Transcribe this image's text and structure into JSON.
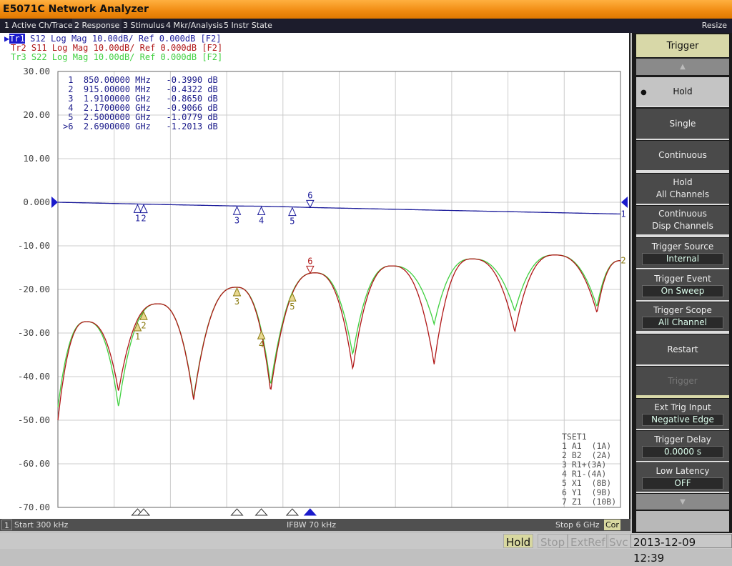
{
  "window": {
    "title": "E5071C Network Analyzer",
    "resize": "Resize"
  },
  "menu": [
    "1 Active Ch/Trace",
    "2 Response",
    "3 Stimulus",
    "4 Mkr/Analysis",
    "5 Instr State"
  ],
  "menu_active": 1,
  "traces": [
    {
      "id": "Tr1",
      "text": " S12 Log Mag 10.00dB/ Ref 0.000dB [F2]",
      "color": "#1a1a9a"
    },
    {
      "id": "Tr2",
      "text": " S11 Log Mag 10.00dB/ Ref 0.000dB [F2]",
      "color": "#b01818"
    },
    {
      "id": "Tr3",
      "text": " S22 Log Mag 10.00dB/ Ref 0.000dB [F2]",
      "color": "#40d040"
    }
  ],
  "markers": [
    {
      "label": " 1",
      "freq": "850.00000 MHz",
      "value": "-0.3990 dB"
    },
    {
      "label": " 2",
      "freq": "915.00000 MHz",
      "value": "-0.4322 dB"
    },
    {
      "label": " 3",
      "freq": "1.9100000 GHz",
      "value": "-0.8650 dB"
    },
    {
      "label": " 4",
      "freq": "2.1700000 GHz",
      "value": "-0.9066 dB"
    },
    {
      "label": " 5",
      "freq": "2.5000000 GHz",
      "value": "-1.0779 dB"
    },
    {
      "label": ">6",
      "freq": "2.6900000 GHz",
      "value": "-1.2013 dB"
    }
  ],
  "tset": [
    "TSET1",
    "1 A1  (1A)",
    "2 B2  (2A)",
    "3 R1+(3A)",
    "4 R1-(4A)",
    "5 X1  (8B)",
    "6 Y1  (9B)",
    "7 Z1  (10B)"
  ],
  "chart_data": {
    "type": "line",
    "xlim_ghz": [
      0.0003,
      6
    ],
    "ylim": [
      -70,
      30
    ],
    "yticks": [
      "30.00",
      "20.00",
      "10.00",
      "0.000",
      "-10.00",
      "-20.00",
      "-30.00",
      "-40.00",
      "-50.00",
      "-60.00",
      "-70.00"
    ],
    "grid": true,
    "series": [
      {
        "name": "S12",
        "color": "#1a1a9a",
        "x": [
          0.0003,
          0.85,
          0.915,
          1.91,
          2.17,
          2.5,
          2.69,
          4,
          6
        ],
        "y": [
          0,
          -0.399,
          -0.4322,
          -0.865,
          -0.9066,
          -1.0779,
          -1.2013,
          -1.8,
          -2.7
        ]
      },
      {
        "name": "S11",
        "color": "#b01818",
        "x": [
          0.0003,
          0.305,
          0.647,
          1.066,
          1.447,
          1.904,
          2.269,
          2.741,
          3.145,
          3.563,
          4.013,
          4.416,
          4.873,
          5.299,
          5.749,
          6.0
        ],
        "y": [
          -50,
          -27.4,
          -43.4,
          -23.3,
          -45.4,
          -19.5,
          -43.4,
          -16.2,
          -38.4,
          -14.6,
          -37.2,
          -13,
          -29.8,
          -12.1,
          -25.4,
          -13.4
        ]
      },
      {
        "name": "S22",
        "color": "#40d040",
        "x": [
          0.0003,
          0.305,
          0.647,
          1.066,
          1.447,
          1.904,
          2.269,
          2.741,
          3.145,
          3.563,
          4.013,
          4.416,
          4.873,
          5.299,
          5.749,
          6.0
        ],
        "y": [
          -47,
          -27.4,
          -47,
          -23.3,
          -45,
          -19.5,
          -42,
          -16.2,
          -35,
          -14.6,
          -28,
          -13,
          -25,
          -12.1,
          -24,
          -13.4
        ]
      }
    ],
    "marker_freqs_ghz": [
      0.85,
      0.915,
      1.91,
      2.17,
      2.5,
      2.69
    ],
    "marker_labels": [
      "1",
      "2",
      "3",
      "4",
      "5",
      "6"
    ],
    "active_marker": 6
  },
  "channel_bar": {
    "ch": "1",
    "start": "Start 300 kHz",
    "ifbw": "IFBW 70 kHz",
    "stop": "Stop 6 GHz",
    "cor": "Cor"
  },
  "status": {
    "hold": "Hold",
    "stop": "Stop",
    "extref": "ExtRef",
    "svc": "Svc",
    "datetime": "2013-12-09 12:39"
  },
  "softkeys": {
    "title": "Trigger",
    "hold": "Hold",
    "single": "Single",
    "continuous": "Continuous",
    "hold_all_1": "Hold",
    "hold_all_2": "All Channels",
    "cont_disp_1": "Continuous",
    "cont_disp_2": "Disp Channels",
    "source": "Trigger Source",
    "source_val": "Internal",
    "event": "Trigger Event",
    "event_val": "On Sweep",
    "scope": "Trigger Scope",
    "scope_val": "All Channel",
    "restart": "Restart",
    "trigger": "Trigger",
    "ext": "Ext Trig Input",
    "ext_val": "Negative Edge",
    "delay": "Trigger Delay",
    "delay_val": "0.0000 s",
    "latency": "Low Latency",
    "latency_val": "OFF"
  }
}
